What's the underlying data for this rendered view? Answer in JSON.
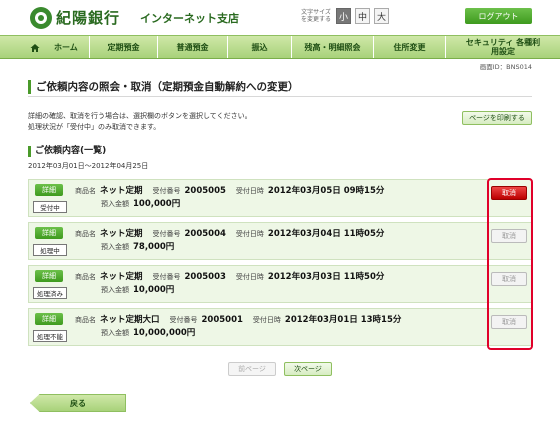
{
  "header": {
    "bank_name": "紀陽銀行",
    "branch_name": "インターネット支店",
    "textsize_label": "文字サイズを変更する",
    "textsize_options": [
      "小",
      "中",
      "大"
    ],
    "logout_label": "ログアウト"
  },
  "nav": {
    "items": [
      "ホーム",
      "定期預金",
      "普通預金",
      "振込",
      "残高・明細照会",
      "住所変更",
      "セキュリティ 各種利用設定"
    ]
  },
  "screen_id": "画面ID：BNS014",
  "page_title": "ご依頼内容の照会・取消（定期預金自動解約への変更）",
  "description": [
    "詳細の確認、取消を行う場合は、選択欄のボタンを選択してください。",
    "処理状況が「受付中」のみ取消できます。"
  ],
  "print_label": "ページを印刷する",
  "section_title": "ご依頼内容(一覧)",
  "date_range": "2012年03月01日〜2012年04月25日",
  "labels": {
    "detail": "詳細",
    "product": "商品名",
    "receipt_no": "受付番号",
    "receipt_date": "受付日時",
    "deposit": "預入金額",
    "cancel": "取消"
  },
  "rows": [
    {
      "status": "受付中",
      "product": "ネット定期",
      "receipt_no": "2005005",
      "receipt_date": "2012年03月05日 09時15分",
      "amount": "100,000円",
      "cancel_enabled": true
    },
    {
      "status": "処理中",
      "product": "ネット定期",
      "receipt_no": "2005004",
      "receipt_date": "2012年03月04日 11時05分",
      "amount": "78,000円",
      "cancel_enabled": false
    },
    {
      "status": "処理済み",
      "product": "ネット定期",
      "receipt_no": "2005003",
      "receipt_date": "2012年03月03日 11時50分",
      "amount": "10,000円",
      "cancel_enabled": false
    },
    {
      "status": "処理不能",
      "product": "ネット定期大口",
      "receipt_no": "2005001",
      "receipt_date": "2012年03月01日 13時15分",
      "amount": "10,000,000円",
      "cancel_enabled": false
    }
  ],
  "pager": {
    "prev": "前ページ",
    "next": "次ページ"
  },
  "back_label": "戻る"
}
